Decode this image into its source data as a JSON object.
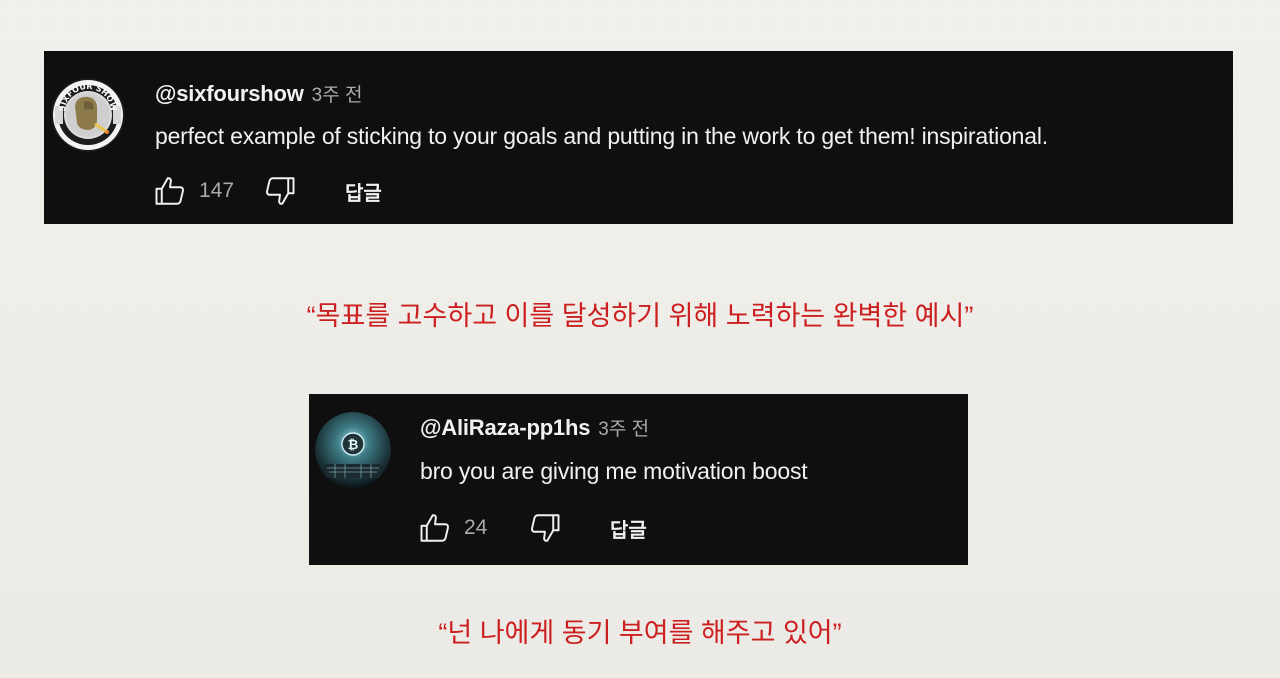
{
  "comments": [
    {
      "username": "@sixfourshow",
      "time": "3주 전",
      "text": "perfect example of sticking to your goals and putting in the work to get them! inspirational.",
      "likes": "147",
      "reply_label": "답글",
      "avatar_text": "SIXFOUR SHOW"
    },
    {
      "username": "@AliRaza-pp1hs",
      "time": "3주 전",
      "text": "bro you are giving me motivation boost",
      "likes": "24",
      "reply_label": "답글",
      "avatar_icon": "bitcoin-icon"
    }
  ],
  "translations": [
    "“목표를 고수하고 이를 달성하기 위해 노력하는 완벽한 예시”",
    "“넌 나에게 동기 부여를 해주고 있어”"
  ],
  "colors": {
    "card_bg": "#0f0f0f",
    "text_primary": "#f1f1f1",
    "text_secondary": "#aaaaaa",
    "translation_red": "#cc1f1f"
  }
}
